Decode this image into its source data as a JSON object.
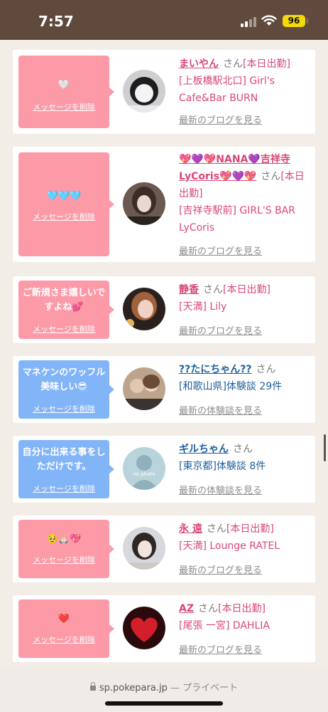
{
  "status": {
    "time": "7:57",
    "battery": "96"
  },
  "browser": {
    "url": "sp.pokepara.jp",
    "separator": " — ",
    "mode": "プライベート"
  },
  "common": {
    "san": "さん",
    "delete_label": "メッセージを削除"
  },
  "cards": [
    {
      "message": "🤍",
      "bubble_color": "pink",
      "name": "まいやん",
      "status": "[本日出勤]",
      "detail": "[上板橋駅北口] Girl's Cafe&Bar BURN",
      "link": "最新のブログを見る",
      "text_color": "#d9467a"
    },
    {
      "message": "🩵🩵🩵",
      "bubble_color": "pink",
      "name": "💖💜💖NANA💜吉祥寺LyCoris💖💜💖",
      "status": "[本日出勤]",
      "detail": "[吉祥寺駅前] GIRL'S BAR LyCoris",
      "link": "最新のブログを見る",
      "text_color": "#d9467a"
    },
    {
      "message": "ご新規さま嬉しいですよね💕",
      "bubble_color": "pink",
      "name": "静香",
      "status": "[本日出勤]",
      "detail": "[天満] Lily",
      "link": "最新のブログを見る",
      "text_color": "#d9467a"
    },
    {
      "message": "マネケンのワッフル美味しい😎",
      "bubble_color": "blue",
      "name": "??たにちゃん??",
      "status": "",
      "detail": "[和歌山県]体験談 29件",
      "link": "最新の体験談を見る",
      "text_color": "#1f5f9c"
    },
    {
      "message": "自分に出来る事をしただけです。",
      "bubble_color": "blue",
      "name": "ギルちゃん",
      "status": "",
      "detail": "[東京都]体験談 8件",
      "link": "最新の体験談を見る",
      "text_color": "#1f5f9c"
    },
    {
      "message": "🥹🙏🏻💖",
      "bubble_color": "pink",
      "name": "永 遠",
      "status": "[本日出勤]",
      "detail": "[天満] Lounge RATEL",
      "link": "最新のブログを見る",
      "text_color": "#d9467a"
    },
    {
      "message": "❤️",
      "bubble_color": "pink",
      "name": "AZ",
      "status": "[本日出勤]",
      "detail": "[尾張 一宮] DAHLIA",
      "link": "最新のブログを見る",
      "text_color": "#d9467a"
    }
  ]
}
